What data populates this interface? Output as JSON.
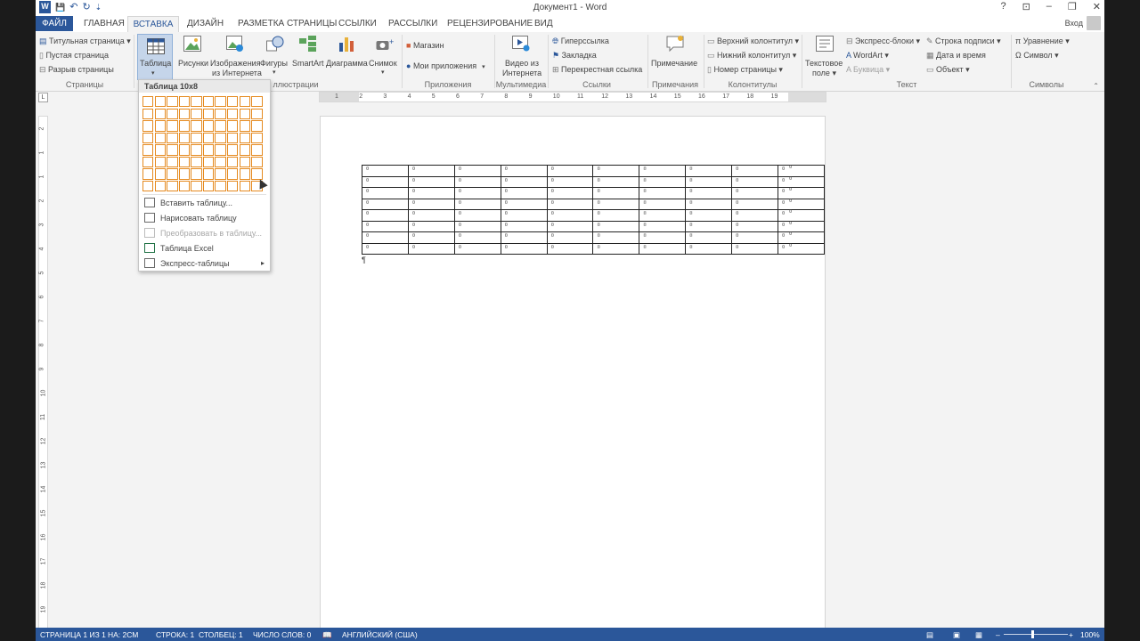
{
  "window": {
    "title": "Документ1 - Word",
    "signin": "Вход",
    "controls": [
      "?",
      "⊡",
      "–",
      "❐",
      "✕"
    ]
  },
  "qat": {
    "word_logo": "W",
    "save": "💾",
    "undo": "↶",
    "redo": "↻",
    "more": "⇣"
  },
  "tabs": {
    "file": "ФАЙЛ",
    "items": [
      "ГЛАВНАЯ",
      "ВСТАВКА",
      "ДИЗАЙН",
      "РАЗМЕТКА СТРАНИЦЫ",
      "ССЫЛКИ",
      "РАССЫЛКИ",
      "РЕЦЕНЗИРОВАНИЕ",
      "ВИД"
    ],
    "active": "ВСТАВКА"
  },
  "ribbon": {
    "pages": {
      "group": "Страницы",
      "items": [
        "Титульная страница ▾",
        "Пустая страница",
        "Разрыв страницы"
      ]
    },
    "tables": {
      "label": "Таблица",
      "arrow": "▾"
    },
    "illustrations": {
      "group": "Иллюстрации",
      "group_visible_fragment": "ллюстрации",
      "pictures": "Рисунки",
      "online_pictures_1": "Изображения",
      "online_pictures_2": "из Интернета",
      "shapes": "Фигуры",
      "shapes_arrow": "▾",
      "smartart": "SmartArt",
      "chart": "Диаграмма",
      "screenshot": "Снимок",
      "screenshot_arrow": "▾"
    },
    "apps": {
      "group": "Приложения",
      "store": "Магазин",
      "my_apps": "Мои приложения",
      "my_apps_arrow": "▾"
    },
    "media": {
      "group": "Мультимедиа",
      "video_1": "Видео из",
      "video_2": "Интернета"
    },
    "links": {
      "group": "Ссылки",
      "items": [
        "Гиперссылка",
        "Закладка",
        "Перекрестная ссылка"
      ]
    },
    "comments": {
      "group": "Примечания",
      "comment": "Примечание"
    },
    "header_footer": {
      "group": "Колонтитулы",
      "items": [
        "Верхний колонтитул ▾",
        "Нижний колонтитул ▾",
        "Номер страницы ▾"
      ]
    },
    "text": {
      "group": "Текст",
      "textbox_1": "Текстовое",
      "textbox_2": "поле ▾",
      "col1": [
        "Экспресс-блоки ▾",
        "WordArt ▾",
        "Буквица ▾"
      ],
      "col2": [
        "Строка подписи ▾",
        "Дата и время",
        "Объект ▾"
      ]
    },
    "symbols": {
      "group": "Символы",
      "items": [
        "π Уравнение ▾",
        "Ω Символ ▾"
      ]
    }
  },
  "ruler": {
    "corner": "L",
    "h_numbers": [
      "1",
      "2",
      "3",
      "4",
      "5",
      "6",
      "7",
      "8",
      "9",
      "10",
      "11",
      "12",
      "13",
      "14",
      "15",
      "16",
      "17",
      "18",
      "19"
    ],
    "v_numbers": [
      "2",
      "1",
      "1",
      "2",
      "3",
      "4",
      "5",
      "6",
      "7",
      "8",
      "9",
      "10",
      "11",
      "12",
      "13",
      "14",
      "15",
      "16",
      "17",
      "18",
      "19"
    ]
  },
  "insert_table_menu": {
    "header": "Таблица 10x8",
    "grid": {
      "columns": 10,
      "rows": 8,
      "selected_columns": 10,
      "selected_rows": 8
    },
    "items": [
      {
        "label": "Вставить таблицу...",
        "enabled": true
      },
      {
        "label": "Нарисовать таблицу",
        "enabled": true
      },
      {
        "label": "Преобразовать в таблицу...",
        "enabled": false
      },
      {
        "label": "Таблица Excel",
        "enabled": true
      },
      {
        "label": "Экспресс-таблицы",
        "enabled": true,
        "submenu": "▸"
      }
    ]
  },
  "document": {
    "table": {
      "rows": 8,
      "cols": 10,
      "cell_mark": "¤",
      "row_end_mark": "¤"
    },
    "pilcrow": "¶"
  },
  "statusbar": {
    "page": "СТРАНИЦА 1 ИЗ 1",
    "position": "НА: 2СМ",
    "line": "СТРОКА: 1",
    "column": "СТОЛБЕЦ: 1",
    "words": "ЧИСЛО СЛОВ: 0",
    "proofing_icon": "📖",
    "language": "АНГЛИЙСКИЙ (США)",
    "zoom_minus": "–",
    "zoom_plus": "+",
    "zoom": "100%"
  },
  "colors": {
    "accent": "#2b579a",
    "grid_highlight": "#e58a1f",
    "ribbon_bg": "#f3f3f3"
  }
}
